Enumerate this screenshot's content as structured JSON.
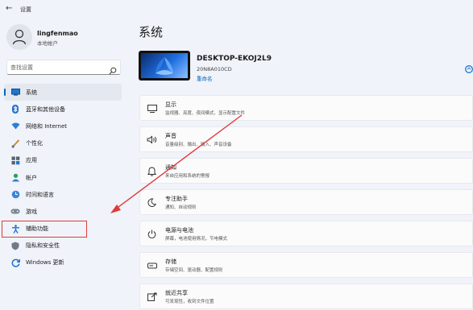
{
  "app": {
    "title": "设置"
  },
  "user": {
    "name": "lingfenmao",
    "account_type": "本地帐户"
  },
  "search": {
    "placeholder": "查找设置"
  },
  "sidebar": {
    "items": [
      {
        "label": "系统",
        "icon": "system-icon",
        "selected": true
      },
      {
        "label": "蓝牙和其他设备",
        "icon": "bluetooth-icon"
      },
      {
        "label": "网络和 Internet",
        "icon": "network-icon"
      },
      {
        "label": "个性化",
        "icon": "personalization-icon"
      },
      {
        "label": "应用",
        "icon": "apps-icon"
      },
      {
        "label": "帐户",
        "icon": "accounts-icon"
      },
      {
        "label": "时间和语言",
        "icon": "time-language-icon"
      },
      {
        "label": "游戏",
        "icon": "gaming-icon"
      },
      {
        "label": "辅助功能",
        "icon": "accessibility-icon"
      },
      {
        "label": "隐私和安全性",
        "icon": "privacy-icon"
      },
      {
        "label": "Windows 更新",
        "icon": "windows-update-icon"
      }
    ]
  },
  "main": {
    "title": "系统",
    "device": {
      "name": "DESKTOP-EKOJ2L9",
      "model": "20N8A010CD",
      "rename_label": "重命名"
    },
    "cards": [
      {
        "title": "显示",
        "desc": "监视器、亮度、夜间模式、显示配置文件",
        "icon": "display-icon"
      },
      {
        "title": "声音",
        "desc": "音量级别、输出、输入、声音设备",
        "icon": "sound-icon"
      },
      {
        "title": "通知",
        "desc": "来自应用和系统的警报",
        "icon": "notification-icon"
      },
      {
        "title": "专注助手",
        "desc": "通知、自动规则",
        "icon": "focus-assist-icon"
      },
      {
        "title": "电源与电池",
        "desc": "屏幕，电池使用情况，节电模式",
        "icon": "power-icon"
      },
      {
        "title": "存储",
        "desc": "存储空间、驱动器、配置规则",
        "icon": "storage-icon"
      },
      {
        "title": "就近共享",
        "desc": "可发现性，收到文件位置",
        "icon": "nearby-share-icon"
      }
    ]
  },
  "colors": {
    "accent": "#0067c0",
    "annotation": "#e03a3a",
    "background": "#f0f3f9"
  }
}
